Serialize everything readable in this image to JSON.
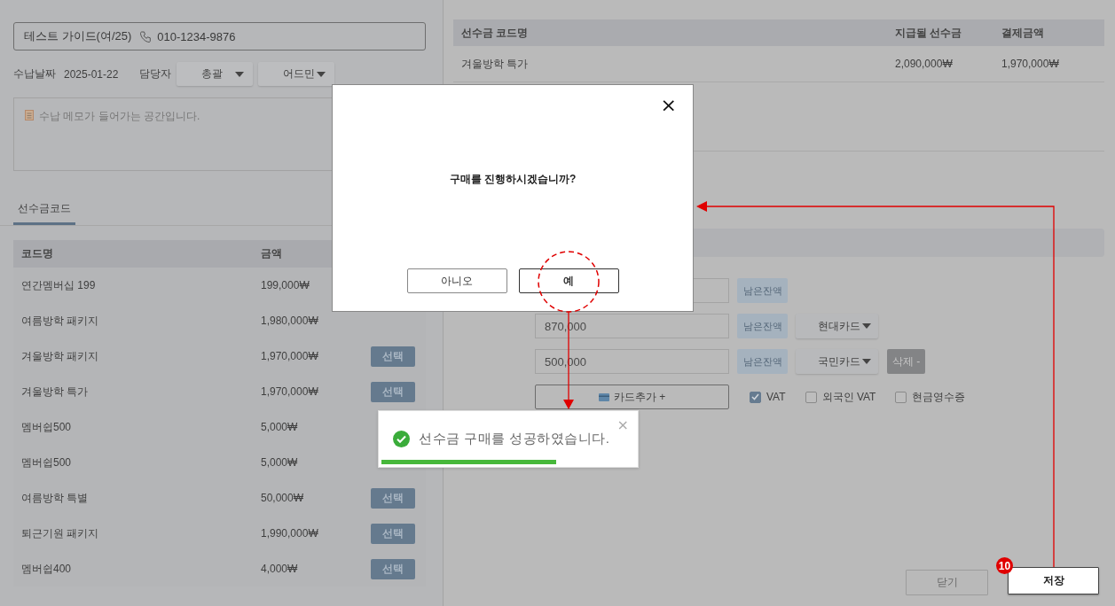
{
  "customer": {
    "name": "테스트 가이드(여/25)",
    "phone": "010-1234-9876"
  },
  "payment_info": {
    "date_label": "수납날짜",
    "date": "2025-01-22",
    "staff_label": "담당자",
    "staff_selects": [
      "총괄",
      "어드민"
    ]
  },
  "memo": {
    "placeholder": "수납 메모가 들어가는 공간입니다."
  },
  "tabs": [
    {
      "label": "선수금코드",
      "selected": true
    }
  ],
  "code_table": {
    "columns": [
      "코드명",
      "금액"
    ],
    "rows": [
      {
        "name": "연간멤버십 199",
        "amount": "199,000₩"
      },
      {
        "name": "여름방학 패키지",
        "amount": "1,980,000₩"
      },
      {
        "name": "겨울방학 패키지",
        "amount": "1,970,000₩",
        "button": "선택"
      },
      {
        "name": "겨울방학 특가",
        "amount": "1,970,000₩",
        "button": "선택"
      },
      {
        "name": "멤버쉽500",
        "amount": "5,000₩"
      },
      {
        "name": "멤버쉽500",
        "amount": "5,000₩"
      },
      {
        "name": "여름방학 특별",
        "amount": "50,000₩",
        "button": "선택"
      },
      {
        "name": "퇴근기원 패키지",
        "amount": "1,990,000₩",
        "button": "선택"
      },
      {
        "name": "멤버쉽400",
        "amount": "4,000₩",
        "button": "선택"
      }
    ]
  },
  "selected_table": {
    "columns": [
      "선수금 코드명",
      "지급될 선수금",
      "결제금액"
    ],
    "rows": [
      [
        "겨울방학 특가",
        "2,090,000₩",
        "1,970,000₩"
      ]
    ]
  },
  "card_payments": [
    {
      "balance_button": "남은잔액"
    },
    {
      "amount": "870,000",
      "balance_button": "남은잔액",
      "card": "현대카드"
    },
    {
      "amount": "500,000",
      "balance_button": "남은잔액",
      "card": "국민카드",
      "delete_button": "삭제 -"
    }
  ],
  "add_card_button": "카드추가 +",
  "options": [
    {
      "label": "VAT",
      "checked": true
    },
    {
      "label": "외국인 VAT",
      "checked": false
    },
    {
      "label": "현금영수증",
      "checked": false
    }
  ],
  "footer_buttons": [
    {
      "label": "닫기",
      "kind": "secondary"
    },
    {
      "label": "저장",
      "kind": "primary"
    }
  ],
  "step_badge": "10",
  "dialog": {
    "close": "×",
    "message": "구매를 진행하시겠습니까?",
    "buttons": [
      "아니오",
      "예"
    ]
  },
  "toast": {
    "message": "선수금 구매를 성공하였습니다.",
    "close": "×",
    "level": 0.69
  }
}
